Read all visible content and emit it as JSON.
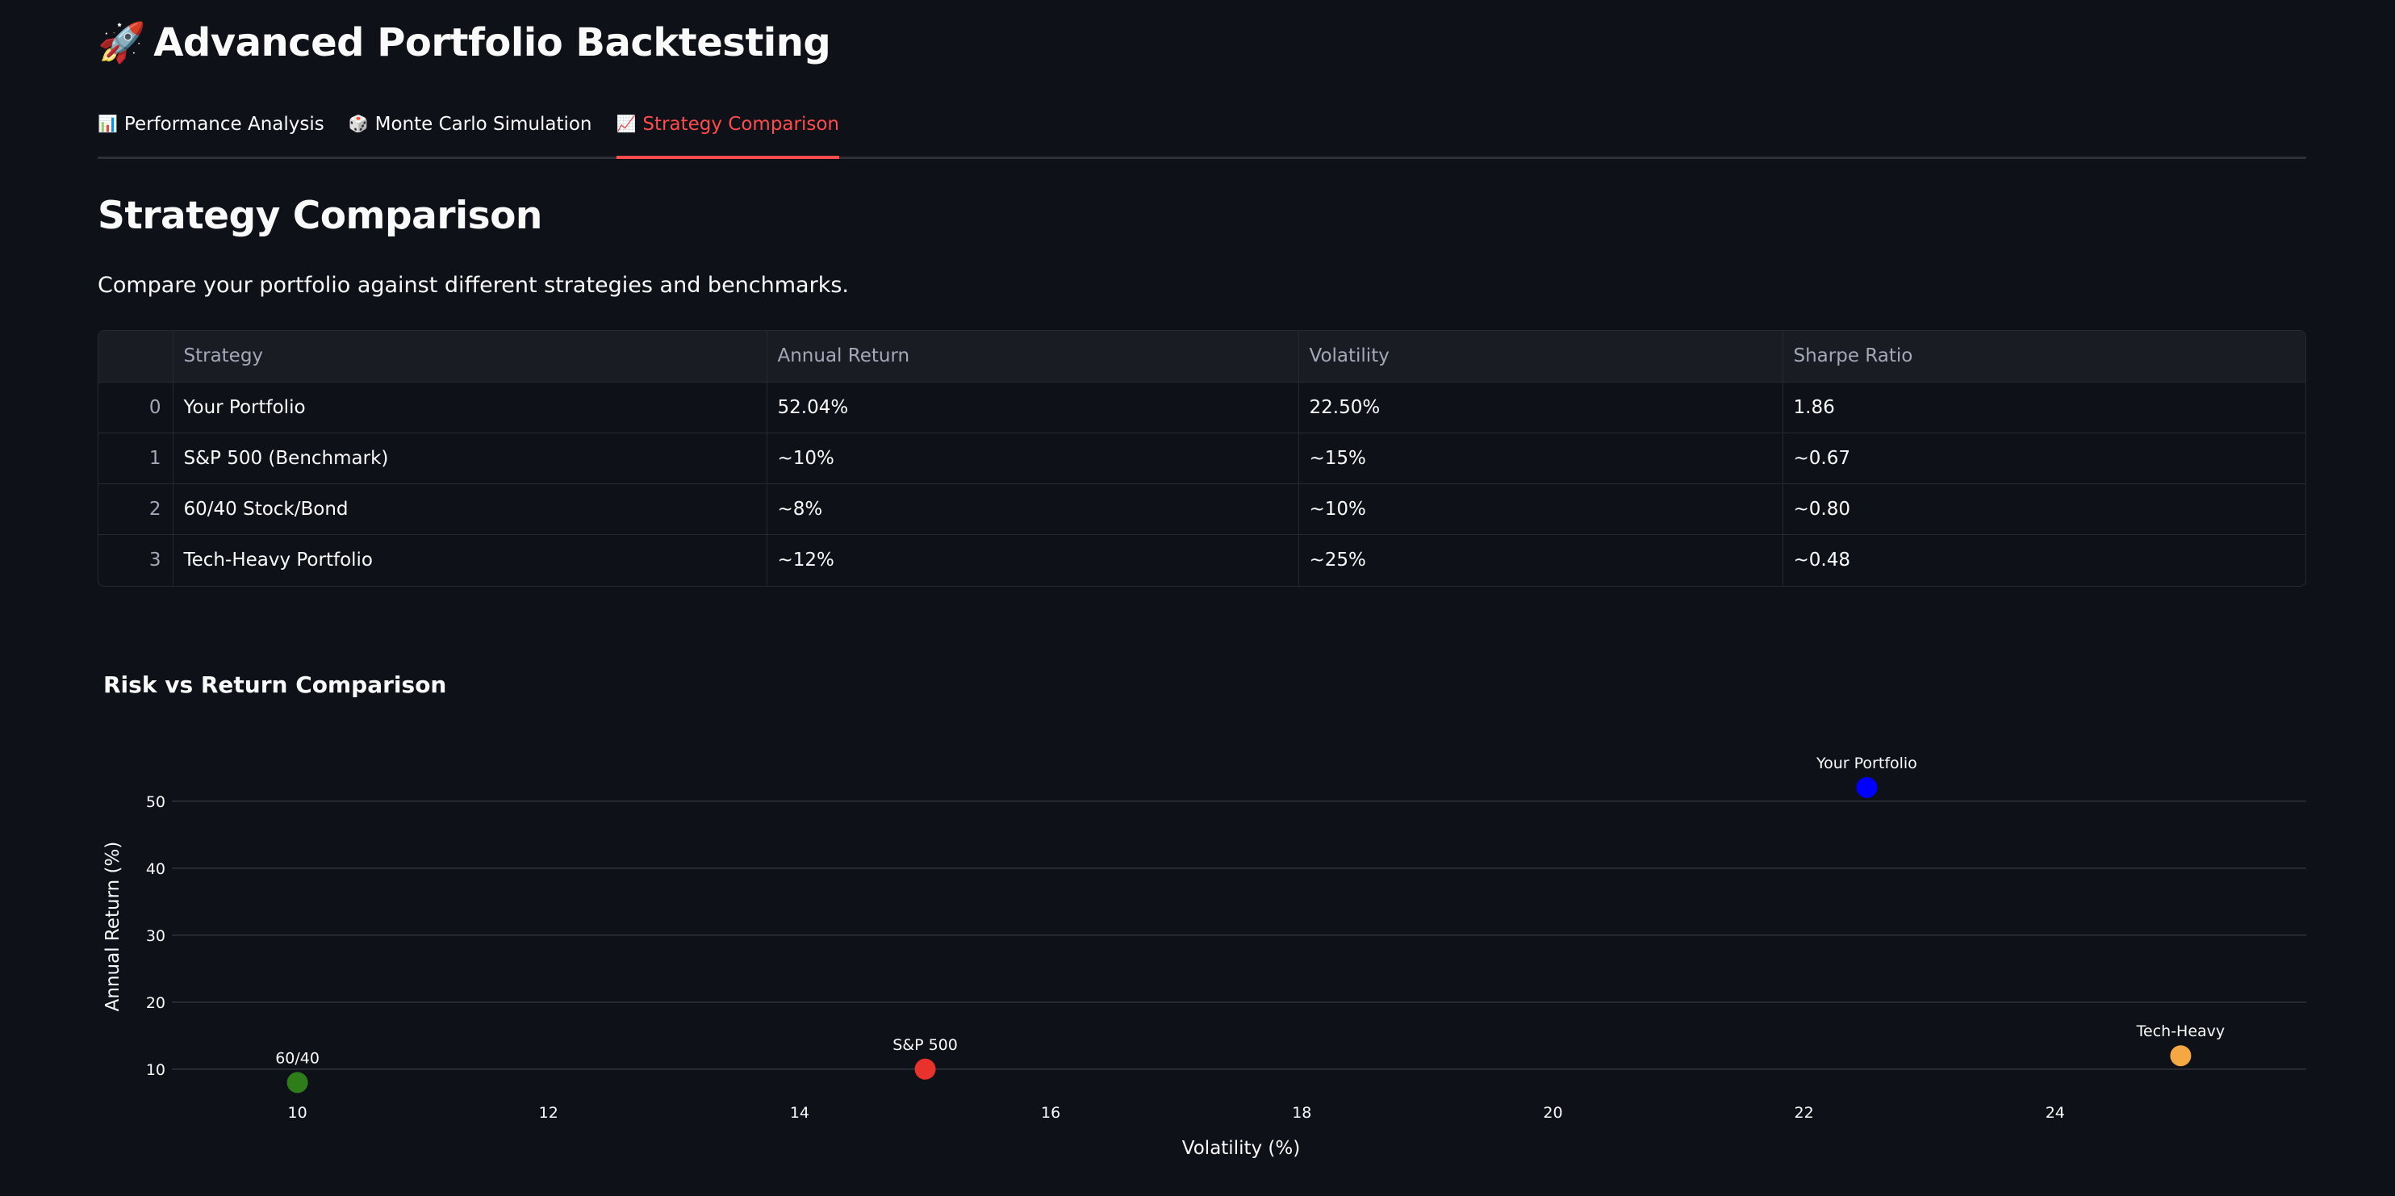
{
  "app": {
    "title_icon": "🚀",
    "title": "Advanced Portfolio Backtesting"
  },
  "tabs": [
    {
      "icon": "📊",
      "label": "Performance Analysis",
      "active": false
    },
    {
      "icon": "🎲",
      "label": "Monte Carlo Simulation",
      "active": false
    },
    {
      "icon": "📈",
      "label": "Strategy Comparison",
      "active": true
    }
  ],
  "section": {
    "title": "Strategy Comparison",
    "description": "Compare your portfolio against different strategies and benchmarks."
  },
  "table": {
    "columns": [
      "",
      "Strategy",
      "Annual Return",
      "Volatility",
      "Sharpe Ratio"
    ],
    "rows": [
      [
        "0",
        "Your Portfolio",
        "52.04%",
        "22.50%",
        "1.86"
      ],
      [
        "1",
        "S&P 500 (Benchmark)",
        "~10%",
        "~15%",
        "~0.67"
      ],
      [
        "2",
        "60/40 Stock/Bond",
        "~8%",
        "~10%",
        "~0.80"
      ],
      [
        "3",
        "Tech-Heavy Portfolio",
        "~12%",
        "~25%",
        "~0.48"
      ]
    ]
  },
  "colors": {
    "accent": "#ff4b4b",
    "background": "#0e1117"
  },
  "chart_data": {
    "type": "scatter",
    "title": "Risk vs Return Comparison",
    "xlabel": "Volatility (%)",
    "ylabel": "Annual Return (%)",
    "xlim": [
      9,
      26
    ],
    "ylim": [
      6,
      56
    ],
    "xticks": [
      10,
      12,
      14,
      16,
      18,
      20,
      22,
      24
    ],
    "yticks": [
      10,
      20,
      30,
      40,
      50
    ],
    "grid": "horizontal",
    "points": [
      {
        "label": "Your Portfolio",
        "x": 22.5,
        "y": 52.04,
        "color": "#0000ff"
      },
      {
        "label": "S&P 500",
        "x": 15,
        "y": 10,
        "color": "#e8322b"
      },
      {
        "label": "60/40",
        "x": 10,
        "y": 8,
        "color": "#2e7d1a"
      },
      {
        "label": "Tech-Heavy",
        "x": 25,
        "y": 12,
        "color": "#f5a742"
      }
    ]
  }
}
